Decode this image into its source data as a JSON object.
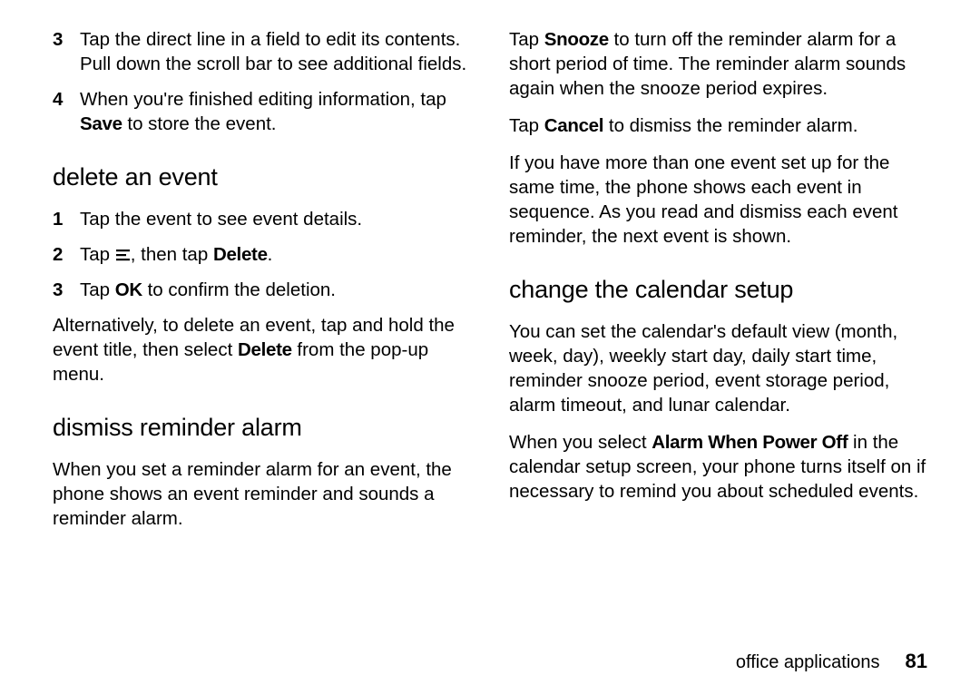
{
  "left": {
    "step3": {
      "num": "3",
      "text_a": "Tap the direct line in a field to edit its contents. Pull down the scroll bar to see additional fields."
    },
    "step4": {
      "num": "4",
      "text_a": "When you're finished editing information, tap ",
      "bold1": "Save",
      "text_b": " to store the event."
    },
    "h_delete": "delete an event",
    "d_step1": {
      "num": "1",
      "text": "Tap the event to see event details."
    },
    "d_step2": {
      "num": "2",
      "text_a": "Tap ",
      "text_b": ", then tap ",
      "bold1": "Delete",
      "text_c": "."
    },
    "d_step3": {
      "num": "3",
      "text_a": "Tap ",
      "bold1": "OK",
      "text_b": " to confirm the deletion."
    },
    "alt_a": "Alternatively, to delete an event, tap and hold the event title, then select ",
    "alt_bold": "Delete",
    "alt_b": " from the pop-up menu.",
    "h_dismiss": "dismiss reminder alarm",
    "dismiss_p": "When you set a reminder alarm for an event, the phone shows an event reminder and sounds a reminder alarm."
  },
  "right": {
    "snooze_a": "Tap ",
    "snooze_bold": "Snooze",
    "snooze_b": " to turn off the reminder alarm for a short period of time. The reminder alarm sounds again when the snooze period expires.",
    "cancel_a": "Tap ",
    "cancel_bold": "Cancel",
    "cancel_b": " to dismiss the reminder alarm.",
    "multi": "If you have more than one event set up for the same time, the phone shows each event in sequence. As you read and dismiss each event reminder, the next event is shown.",
    "h_change": "change the calendar setup",
    "change_p": "You can set the calendar's default view (month, week, day), weekly start day, daily start time, reminder snooze period, event storage period, alarm timeout, and lunar calendar.",
    "pwr_a": "When you select ",
    "pwr_bold": "Alarm When Power Off",
    "pwr_b": " in the calendar setup screen, your phone turns itself on if necessary to remind you about scheduled events."
  },
  "footer": {
    "section": "office applications",
    "page": "81"
  }
}
